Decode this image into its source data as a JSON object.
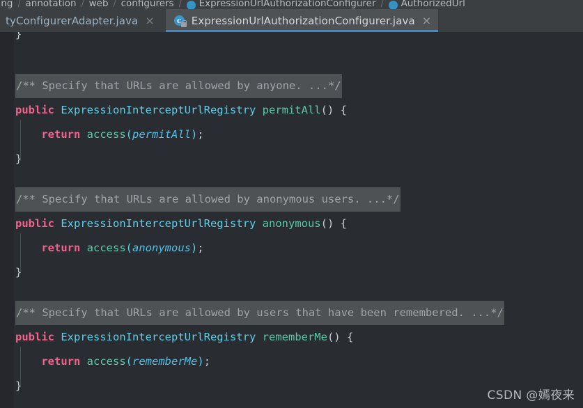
{
  "breadcrumb": {
    "name": "breadcrumb",
    "items": [
      {
        "label": "ring",
        "icon": null
      },
      {
        "label": "annotation",
        "icon": null
      },
      {
        "label": "web",
        "icon": null
      },
      {
        "label": "configurers",
        "icon": null
      },
      {
        "label": "ExpressionUrlAuthorizationConfigurer",
        "icon": "class-icon"
      },
      {
        "label": "AuthorizedUrl",
        "icon": "class-icon"
      }
    ],
    "separator": "/"
  },
  "tabs": [
    {
      "label": "tyConfigurerAdapter.java",
      "active": false,
      "icon": null,
      "close": "×"
    },
    {
      "label": "ExpressionUrlAuthorizationConfigurer.java",
      "active": true,
      "icon": "java-class-locked-icon",
      "icon_glyph": "c",
      "close": "×"
    }
  ],
  "editor": {
    "top_partial_line": "}",
    "blocks": [
      {
        "comment": "/** Specify that URLs are allowed by anyone. ...*/",
        "signature": {
          "modifier": "public",
          "return_type": "ExpressionInterceptUrlRegistry",
          "method": "permitAll",
          "parens": "()",
          "open_brace": "{"
        },
        "body": {
          "keyword": "return",
          "call": "access",
          "open_paren": "(",
          "argument": "permitAll",
          "close_paren": ")",
          "semicolon": ";"
        },
        "close_brace": "}"
      },
      {
        "comment": "/** Specify that URLs are allowed by anonymous users. ...*/",
        "signature": {
          "modifier": "public",
          "return_type": "ExpressionInterceptUrlRegistry",
          "method": "anonymous",
          "parens": "()",
          "open_brace": "{"
        },
        "body": {
          "keyword": "return",
          "call": "access",
          "open_paren": "(",
          "argument": "anonymous",
          "close_paren": ")",
          "semicolon": ";"
        },
        "close_brace": "}"
      },
      {
        "comment": "/** Specify that URLs are allowed by users that have been remembered. ...*/",
        "signature": {
          "modifier": "public",
          "return_type": "ExpressionInterceptUrlRegistry",
          "method": "rememberMe",
          "parens": "()",
          "open_brace": "{"
        },
        "body": {
          "keyword": "return",
          "call": "access",
          "open_paren": "(",
          "argument": "rememberMe",
          "close_paren": ")",
          "semicolon": ";"
        },
        "close_brace": "}"
      }
    ]
  },
  "watermark": {
    "text": "CSDN @嫣夜来"
  },
  "colors": {
    "editor_background": "#292c31",
    "gutter_background": "#25272c",
    "tabbar_background": "#3c3f41",
    "active_tab_background": "#4e5254",
    "active_tab_underline": "#3d86d0",
    "fold_highlight": "#4f5255",
    "keyword": "#f2628c",
    "type": "#5fcfe8",
    "method": "#5bc9a6",
    "parameter": "#4fc1e9",
    "comment_text": "#9fa4a8",
    "plain_text": "#c5ccd3"
  }
}
